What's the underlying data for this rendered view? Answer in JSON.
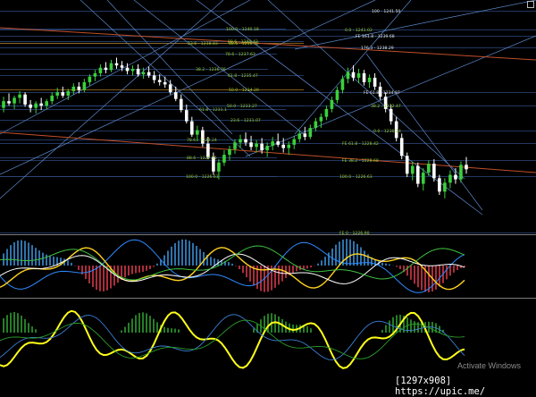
{
  "chart_data": [
    {
      "type": "candlestick",
      "pane": "price",
      "fib_labels": [
        {
          "text": "100 - 1241.50",
          "color": "#e6e6e6"
        },
        {
          "text": "0.0 - 1241.02",
          "color": "#9acd32"
        },
        {
          "text": "FE 161.8 - 1239.68",
          "color": "#e6e6e6"
        },
        {
          "text": "100.0 - 1240.18",
          "color": "#9acd32"
        },
        {
          "text": "88.6 - 1240.42",
          "color": "#9acd32"
        },
        {
          "text": "23.6 - 1238.83",
          "color": "#9acd32"
        },
        {
          "text": "88.6 - 1238.92",
          "color": "#9acd32"
        },
        {
          "text": "176.3 - 1238.29",
          "color": "#e6e6e6"
        },
        {
          "text": "78.6 - 1237.63",
          "color": "#9acd32"
        },
        {
          "text": "38.2 - 1236.76",
          "color": "#9acd32"
        },
        {
          "text": "61.8 - 1235.47",
          "color": "#9acd32"
        },
        {
          "text": "50.0 - 1234.20",
          "color": "#9acd32"
        },
        {
          "text": "FE 61.8 - 1234.97",
          "color": "#e6e6e6"
        },
        {
          "text": "50.0 - 1233.27",
          "color": "#9acd32"
        },
        {
          "text": "38.2 - 1232.47",
          "color": "#9acd32"
        },
        {
          "text": "61.8 - 1231.1",
          "color": "#9acd32"
        },
        {
          "text": "23.6 - 1231.07",
          "color": "#9acd32"
        },
        {
          "text": "0.0 - 1230.24",
          "color": "#9acd32"
        },
        {
          "text": "78.6 - 1229.24",
          "color": "#9acd32"
        },
        {
          "text": "FE 61.8 - 1228.42",
          "color": "#9acd32"
        },
        {
          "text": "88.6 - 1227.55",
          "color": "#9acd32"
        },
        {
          "text": "FE 38.2 - 1228.68",
          "color": "#9acd32"
        },
        {
          "text": "100.0 - 1226.61",
          "color": "#9acd32"
        },
        {
          "text": "100.0 - 1226.63",
          "color": "#9acd32"
        },
        {
          "text": "FE 0 - 1226.90",
          "color": "#9acd32"
        }
      ],
      "candles": [
        [
          1235.0,
          1236.0,
          1234.6,
          1235.6
        ],
        [
          1235.6,
          1236.3,
          1235.2,
          1235.4
        ],
        [
          1235.4,
          1236.1,
          1234.9,
          1235.9
        ],
        [
          1235.9,
          1236.5,
          1235.4,
          1236.2
        ],
        [
          1236.2,
          1236.4,
          1235.1,
          1235.3
        ],
        [
          1235.3,
          1235.7,
          1234.6,
          1235.0
        ],
        [
          1235.0,
          1235.6,
          1234.5,
          1235.4
        ],
        [
          1235.4,
          1235.9,
          1234.8,
          1235.2
        ],
        [
          1235.2,
          1235.8,
          1234.9,
          1235.6
        ],
        [
          1235.6,
          1236.4,
          1235.3,
          1236.1
        ],
        [
          1236.1,
          1236.8,
          1235.8,
          1236.4
        ],
        [
          1236.4,
          1236.9,
          1235.9,
          1236.1
        ],
        [
          1236.1,
          1236.7,
          1235.7,
          1236.5
        ],
        [
          1236.5,
          1237.2,
          1236.2,
          1236.9
        ],
        [
          1236.9,
          1237.3,
          1236.3,
          1236.6
        ],
        [
          1236.6,
          1237.6,
          1236.4,
          1237.3
        ],
        [
          1237.3,
          1238.0,
          1237.0,
          1237.8
        ],
        [
          1237.8,
          1238.4,
          1237.4,
          1238.1
        ],
        [
          1238.1,
          1238.9,
          1237.8,
          1238.6
        ],
        [
          1238.6,
          1239.1,
          1238.1,
          1238.4
        ],
        [
          1238.4,
          1239.3,
          1238.2,
          1239.0
        ],
        [
          1239.0,
          1239.5,
          1238.5,
          1238.8
        ],
        [
          1238.8,
          1239.2,
          1238.3,
          1238.6
        ],
        [
          1238.6,
          1239.0,
          1238.0,
          1238.3
        ],
        [
          1238.3,
          1238.8,
          1237.9,
          1238.5
        ],
        [
          1238.5,
          1238.9,
          1237.8,
          1238.0
        ],
        [
          1238.0,
          1238.6,
          1237.6,
          1238.2
        ],
        [
          1238.2,
          1238.7,
          1237.7,
          1237.9
        ],
        [
          1237.9,
          1238.3,
          1237.2,
          1237.5
        ],
        [
          1237.5,
          1238.0,
          1237.0,
          1237.3
        ],
        [
          1237.3,
          1237.8,
          1236.8,
          1237.1
        ],
        [
          1237.1,
          1237.5,
          1236.2,
          1236.4
        ],
        [
          1236.4,
          1236.9,
          1235.6,
          1235.8
        ],
        [
          1235.8,
          1236.2,
          1234.6,
          1234.8
        ],
        [
          1234.8,
          1235.3,
          1233.6,
          1233.8
        ],
        [
          1233.8,
          1234.2,
          1232.4,
          1232.6
        ],
        [
          1232.6,
          1233.4,
          1232.0,
          1233.0
        ],
        [
          1233.0,
          1233.3,
          1231.5,
          1231.8
        ],
        [
          1231.8,
          1232.4,
          1230.4,
          1230.6
        ],
        [
          1230.6,
          1231.0,
          1229.0,
          1229.3
        ],
        [
          1229.3,
          1230.4,
          1228.6,
          1230.1
        ],
        [
          1230.1,
          1231.2,
          1229.8,
          1230.8
        ],
        [
          1230.8,
          1231.6,
          1230.3,
          1231.3
        ],
        [
          1231.3,
          1232.2,
          1230.9,
          1231.9
        ],
        [
          1231.9,
          1232.6,
          1231.4,
          1232.2
        ],
        [
          1232.2,
          1232.8,
          1231.6,
          1231.9
        ],
        [
          1231.9,
          1232.5,
          1231.2,
          1231.5
        ],
        [
          1231.5,
          1232.1,
          1231.0,
          1231.8
        ],
        [
          1231.8,
          1232.3,
          1230.9,
          1231.2
        ],
        [
          1231.2,
          1231.9,
          1230.6,
          1231.6
        ],
        [
          1231.6,
          1232.4,
          1231.2,
          1232.0
        ],
        [
          1232.0,
          1232.7,
          1231.5,
          1231.7
        ],
        [
          1231.7,
          1232.3,
          1231.0,
          1231.4
        ],
        [
          1231.4,
          1232.0,
          1230.8,
          1231.7
        ],
        [
          1231.7,
          1232.5,
          1231.3,
          1232.2
        ],
        [
          1232.2,
          1233.0,
          1231.9,
          1232.7
        ],
        [
          1232.7,
          1233.3,
          1232.1,
          1232.4
        ],
        [
          1232.4,
          1233.5,
          1232.2,
          1233.2
        ],
        [
          1233.2,
          1234.1,
          1232.9,
          1233.8
        ],
        [
          1233.8,
          1234.5,
          1233.2,
          1234.2
        ],
        [
          1234.2,
          1235.2,
          1233.9,
          1234.9
        ],
        [
          1234.9,
          1236.0,
          1234.6,
          1235.7
        ],
        [
          1235.7,
          1236.9,
          1235.4,
          1236.6
        ],
        [
          1236.6,
          1237.9,
          1236.3,
          1237.6
        ],
        [
          1237.6,
          1238.6,
          1237.2,
          1238.2
        ],
        [
          1238.2,
          1238.8,
          1237.4,
          1237.7
        ],
        [
          1237.7,
          1238.5,
          1237.2,
          1238.1
        ],
        [
          1238.1,
          1238.4,
          1237.0,
          1237.3
        ],
        [
          1237.3,
          1238.0,
          1236.8,
          1237.7
        ],
        [
          1237.7,
          1238.1,
          1236.6,
          1236.9
        ],
        [
          1236.9,
          1237.3,
          1235.7,
          1236.0
        ],
        [
          1236.0,
          1236.4,
          1234.6,
          1234.9
        ],
        [
          1234.9,
          1235.3,
          1233.5,
          1233.8
        ],
        [
          1233.8,
          1234.2,
          1232.0,
          1232.3
        ],
        [
          1232.3,
          1232.7,
          1230.4,
          1230.7
        ],
        [
          1230.7,
          1231.0,
          1228.8,
          1229.1
        ],
        [
          1229.1,
          1230.2,
          1228.5,
          1229.8
        ],
        [
          1229.8,
          1230.1,
          1227.9,
          1228.2
        ],
        [
          1228.2,
          1229.6,
          1227.6,
          1229.2
        ],
        [
          1229.2,
          1230.3,
          1228.9,
          1230.0
        ],
        [
          1230.0,
          1230.4,
          1228.4,
          1228.7
        ],
        [
          1228.7,
          1229.0,
          1227.2,
          1227.5
        ],
        [
          1227.5,
          1228.7,
          1226.9,
          1228.3
        ],
        [
          1228.3,
          1229.4,
          1227.8,
          1229.0
        ],
        [
          1229.0,
          1229.6,
          1228.2,
          1228.6
        ],
        [
          1228.6,
          1230.2,
          1228.3,
          1229.9
        ],
        [
          1229.9,
          1230.6,
          1229.1,
          1229.5
        ]
      ]
    },
    {
      "type": "line",
      "pane": "oscillator-1",
      "series": [
        {
          "color": "#2e8bff"
        },
        {
          "color": "#ffd21e"
        },
        {
          "color": "#ffffff"
        },
        {
          "color": "#3fc23f"
        }
      ]
    },
    {
      "type": "line",
      "pane": "oscillator-2",
      "series": [
        {
          "color": "#ffff1a"
        },
        {
          "color": "#3b7fd6"
        },
        {
          "color": "#2a9d2a"
        }
      ]
    }
  ],
  "price_scale": {
    "min": 1224.0,
    "max": 1244.5
  },
  "colors": {
    "background": "#000000",
    "bull_candle": "#3ad13a",
    "bear_candle": "#ffffff",
    "channel_lines": "#5a86c8",
    "trend_lines": "#c0502a",
    "fib_lines": "#2e4a80",
    "fib_orange": "#b07a1a"
  },
  "watermark": "Activate Windows",
  "credit": "[1297x908] https://upic.me/"
}
